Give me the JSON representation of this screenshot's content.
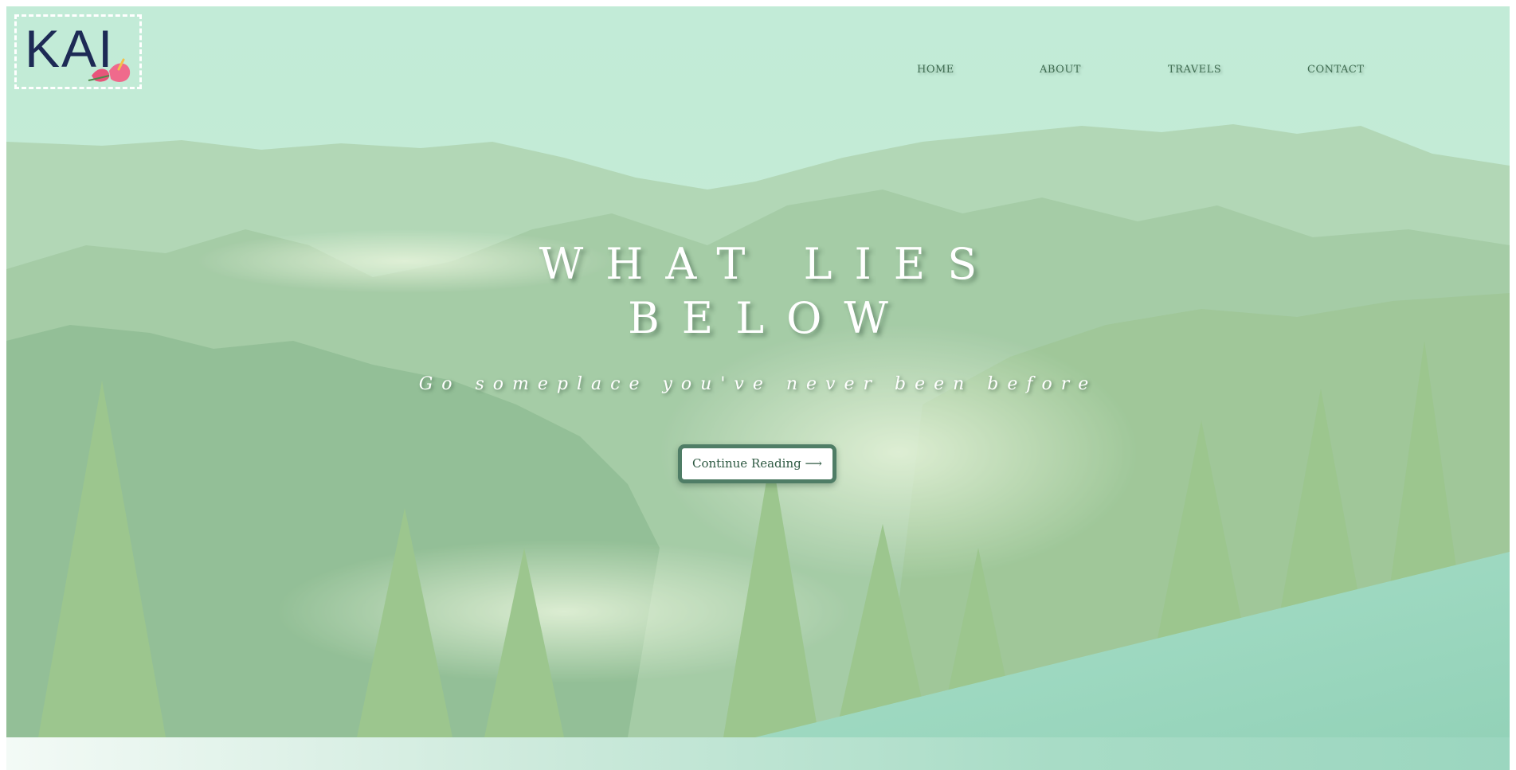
{
  "brand": {
    "logo_text": "KAI"
  },
  "nav": {
    "items": [
      {
        "label": "HOME"
      },
      {
        "label": "ABOUT"
      },
      {
        "label": "TRAVELS"
      },
      {
        "label": "CONTACT"
      }
    ]
  },
  "hero": {
    "title_line_1": "WHAT LIES",
    "title_line_2": "BELOW",
    "subtitle": "Go someplace you've never been before",
    "cta_label": "Continue Reading ⟶"
  },
  "colors": {
    "overlay_mint": "#b9ecd7",
    "accent_teal": "#9ed8c1",
    "button_border": "#4f7d66",
    "nav_text": "#3e6b50",
    "logo_navy": "#1d2a55",
    "logo_pink": "#e8557a"
  },
  "icons": {
    "logo_flower": "anthurium-flower-icon"
  }
}
